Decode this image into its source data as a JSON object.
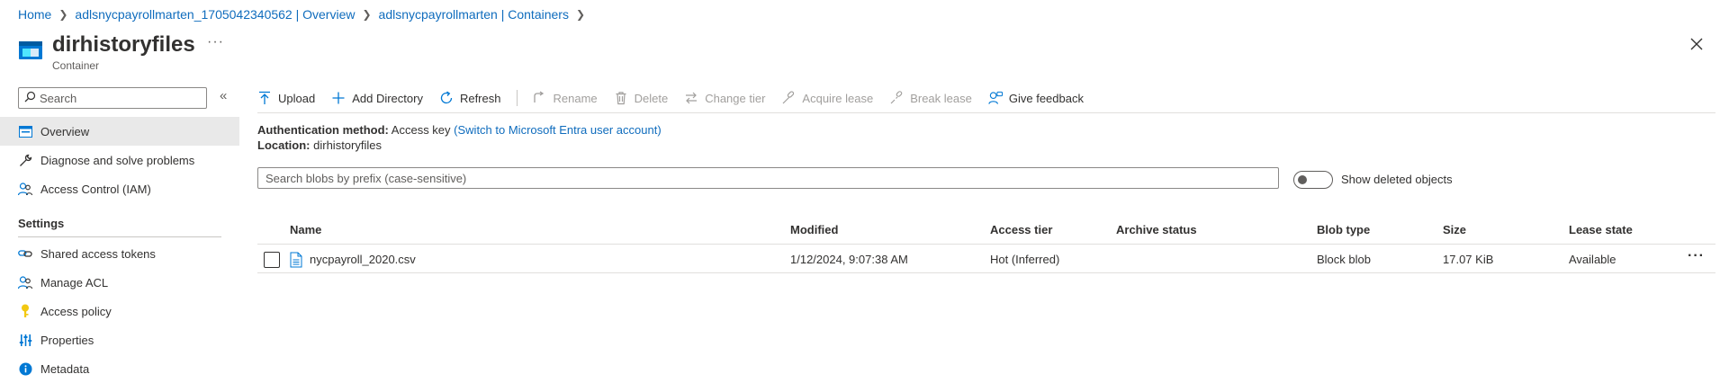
{
  "breadcrumb": {
    "items": [
      "Home",
      "adlsnycpayrollmarten_1705042340562 | Overview",
      "adlsnycpayrollmarten | Containers"
    ],
    "separator": ">"
  },
  "header": {
    "title": "dirhistoryfiles",
    "subtitle": "Container",
    "more": "···"
  },
  "sidebar": {
    "search_placeholder": "Search",
    "collapse_glyph": "«",
    "items": [
      {
        "label": "Overview",
        "icon": "overview-icon"
      },
      {
        "label": "Diagnose and solve problems",
        "icon": "wrench-icon"
      },
      {
        "label": "Access Control (IAM)",
        "icon": "people-icon"
      }
    ],
    "settings_heading": "Settings",
    "settings_items": [
      {
        "label": "Shared access tokens",
        "icon": "link-icon"
      },
      {
        "label": "Manage ACL",
        "icon": "people-icon"
      },
      {
        "label": "Access policy",
        "icon": "key-icon"
      },
      {
        "label": "Properties",
        "icon": "sliders-icon"
      },
      {
        "label": "Metadata",
        "icon": "info-icon"
      }
    ]
  },
  "toolbar": {
    "upload": "Upload",
    "add_directory": "Add Directory",
    "refresh": "Refresh",
    "rename": "Rename",
    "delete": "Delete",
    "change_tier": "Change tier",
    "acquire_lease": "Acquire lease",
    "break_lease": "Break lease",
    "give_feedback": "Give feedback"
  },
  "info": {
    "auth_label": "Authentication method:",
    "auth_value": "Access key",
    "auth_link": "(Switch to Microsoft Entra user account)",
    "location_label": "Location:",
    "location_value": "dirhistoryfiles"
  },
  "blob_search": {
    "placeholder": "Search blobs by prefix (case-sensitive)"
  },
  "show_deleted": {
    "label": "Show deleted objects",
    "enabled": false
  },
  "table": {
    "columns": [
      "Name",
      "Modified",
      "Access tier",
      "Archive status",
      "Blob type",
      "Size",
      "Lease state"
    ],
    "rows": [
      {
        "name": "nycpayroll_2020.csv",
        "modified": "1/12/2024, 9:07:38 AM",
        "access_tier": "Hot (Inferred)",
        "archive_status": "",
        "blob_type": "Block blob",
        "size": "17.07 KiB",
        "lease_state": "Available",
        "more": "···"
      }
    ]
  },
  "colors": {
    "link": "#0f6cbd",
    "text": "#323130",
    "disabled": "#a19f9d",
    "active_nav_bg": "#e9e9e9",
    "container_icon": "#0078d4"
  }
}
